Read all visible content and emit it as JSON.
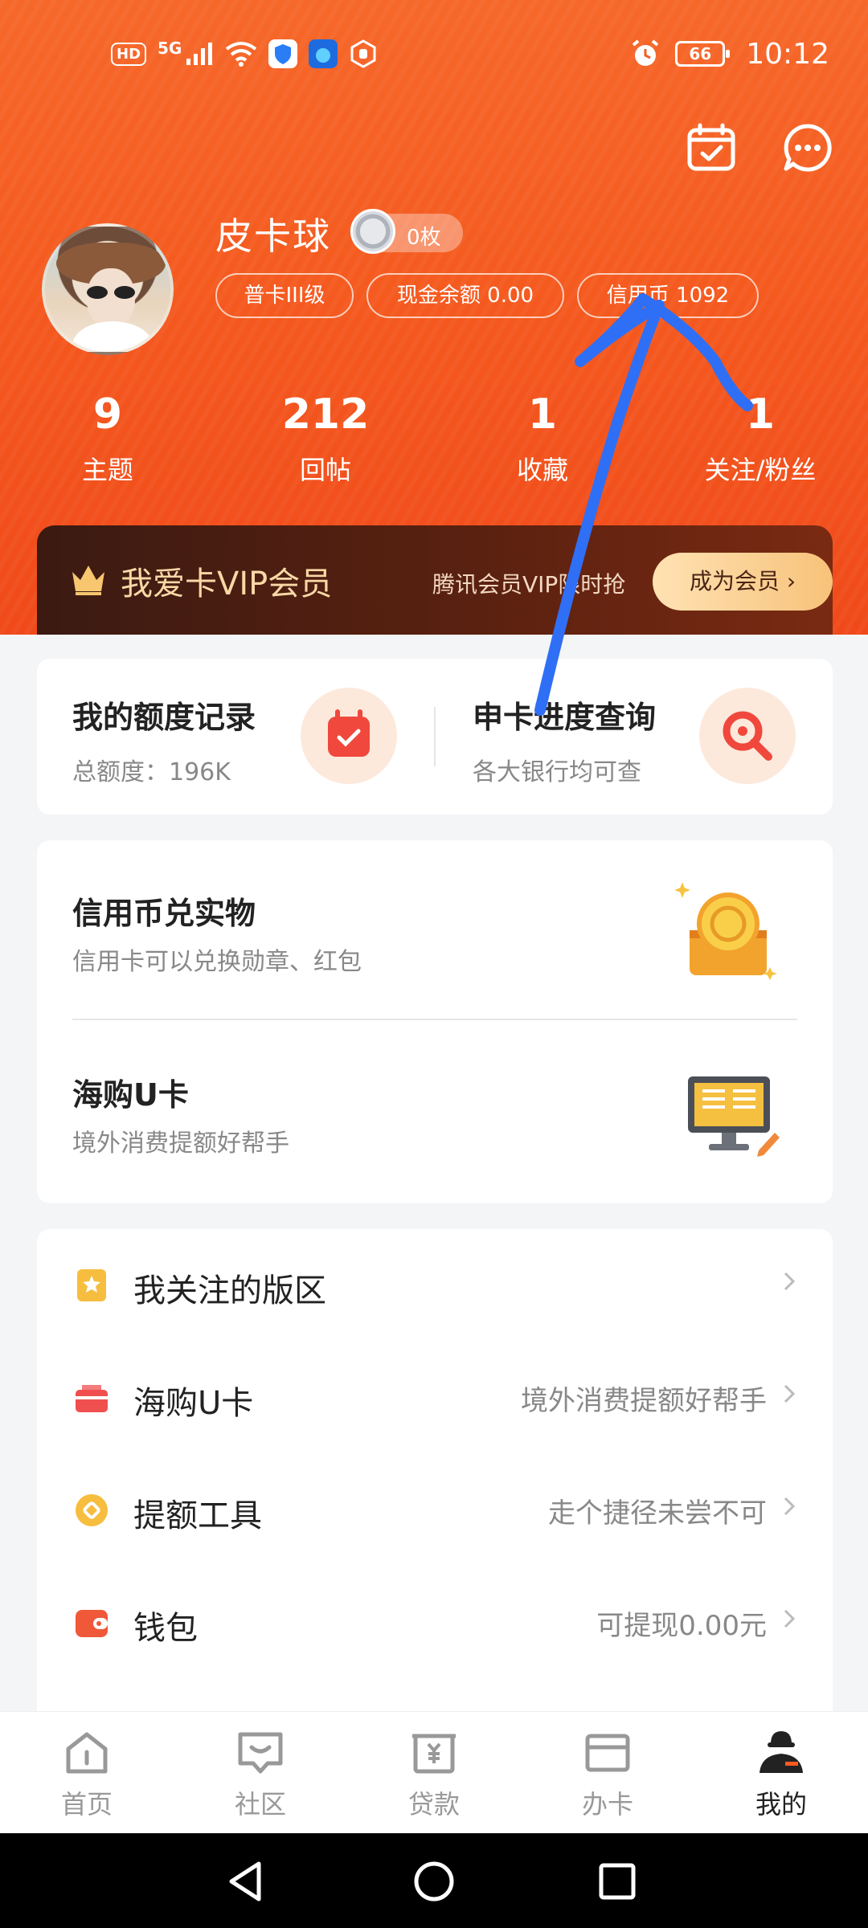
{
  "status_bar": {
    "left_chip": "HD",
    "network": "5G",
    "battery": "66",
    "time": "10:12"
  },
  "profile": {
    "name": "皮卡球",
    "coin_badge": "0枚",
    "tags": [
      "普卡III级",
      "现金余额 0.00",
      "信用币 1092"
    ]
  },
  "stats": [
    {
      "num": "9",
      "label": "主题"
    },
    {
      "num": "212",
      "label": "回帖"
    },
    {
      "num": "1",
      "label": "收藏"
    },
    {
      "num": "1",
      "label": "关注/粉丝"
    }
  ],
  "vip": {
    "title": "我爱卡VIP会员",
    "subtitle": "腾讯会员VIP限时抢",
    "button": "成为会员"
  },
  "quick_cards": [
    {
      "title": "我的额度记录",
      "subtitle": "总额度：196K"
    },
    {
      "title": "申卡进度查询",
      "subtitle": "各大银行均可查"
    }
  ],
  "features": [
    {
      "title": "信用币兑实物",
      "subtitle": "信用卡可以兑换勋章、红包"
    },
    {
      "title": "海购U卡",
      "subtitle": "境外消费提额好帮手"
    }
  ],
  "menu": [
    {
      "label": "我关注的版区",
      "value": ""
    },
    {
      "label": "海购U卡",
      "value": "境外消费提额好帮手"
    },
    {
      "label": "提额工具",
      "value": "走个捷径未尝不可"
    },
    {
      "label": "钱包",
      "value": "可提现0.00元"
    }
  ],
  "tabs": [
    "首页",
    "社区",
    "贷款",
    "办卡",
    "我的"
  ],
  "colors": {
    "header_orange": "#f55a1f",
    "vip_gold": "#f9d8a6",
    "annotation_blue": "#2f6ff5"
  }
}
